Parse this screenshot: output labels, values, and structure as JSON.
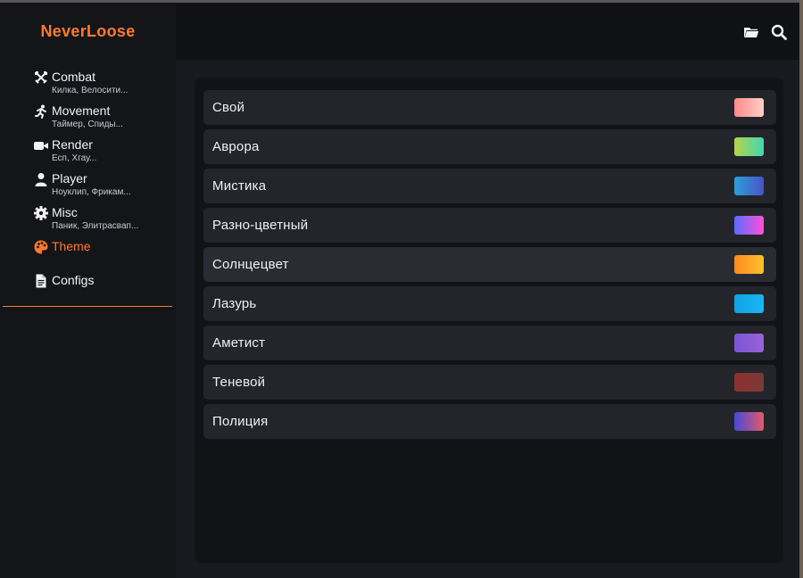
{
  "app": {
    "brand": "NeverLoose"
  },
  "colors": {
    "accent": "#ff7a2f"
  },
  "sidebar": {
    "items": [
      {
        "label": "Combat",
        "subtitle": "Килка, Велосити...",
        "icon": "crossed-swords-icon"
      },
      {
        "label": "Movement",
        "subtitle": "Таймер, Спиды...",
        "icon": "running-person-icon"
      },
      {
        "label": "Render",
        "subtitle": "Есп, Хгау...",
        "icon": "video-camera-icon"
      },
      {
        "label": "Player",
        "subtitle": "Ноуклип, Фрикам...",
        "icon": "user-icon"
      },
      {
        "label": "Misc",
        "subtitle": "Паник, Элитрасвап...",
        "icon": "gear-icon"
      },
      {
        "label": "Theme",
        "subtitle": "",
        "icon": "palette-icon",
        "active": true
      },
      {
        "label": "Configs",
        "subtitle": "",
        "icon": "document-icon"
      }
    ]
  },
  "header": {
    "icons": [
      "folder-icon",
      "search-icon"
    ]
  },
  "themes": [
    {
      "name": "Свой",
      "swatch": [
        "#ff8a8a",
        "#ffd0c8"
      ]
    },
    {
      "name": "Аврора",
      "swatch": [
        "#b7d24a",
        "#3fd9b0"
      ]
    },
    {
      "name": "Мистика",
      "swatch": [
        "#2aa0d8",
        "#4a52c8"
      ]
    },
    {
      "name": "Разно-цветный",
      "swatch": [
        "#5b6cff",
        "#ff4fd8"
      ]
    },
    {
      "name": "Солнцецвет",
      "swatch": [
        "#ff8a1f",
        "#ffc12e"
      ],
      "selected": true
    },
    {
      "name": "Лазурь",
      "swatch": [
        "#0fa3e6",
        "#19b6f0"
      ]
    },
    {
      "name": "Аметист",
      "swatch": [
        "#7a55d6",
        "#9a62d8"
      ]
    },
    {
      "name": "Теневой",
      "swatch": [
        "#8e3030",
        "#7a3a35"
      ]
    },
    {
      "name": "Полиция",
      "swatch": [
        "#4848d8",
        "#e05a6a"
      ]
    }
  ]
}
